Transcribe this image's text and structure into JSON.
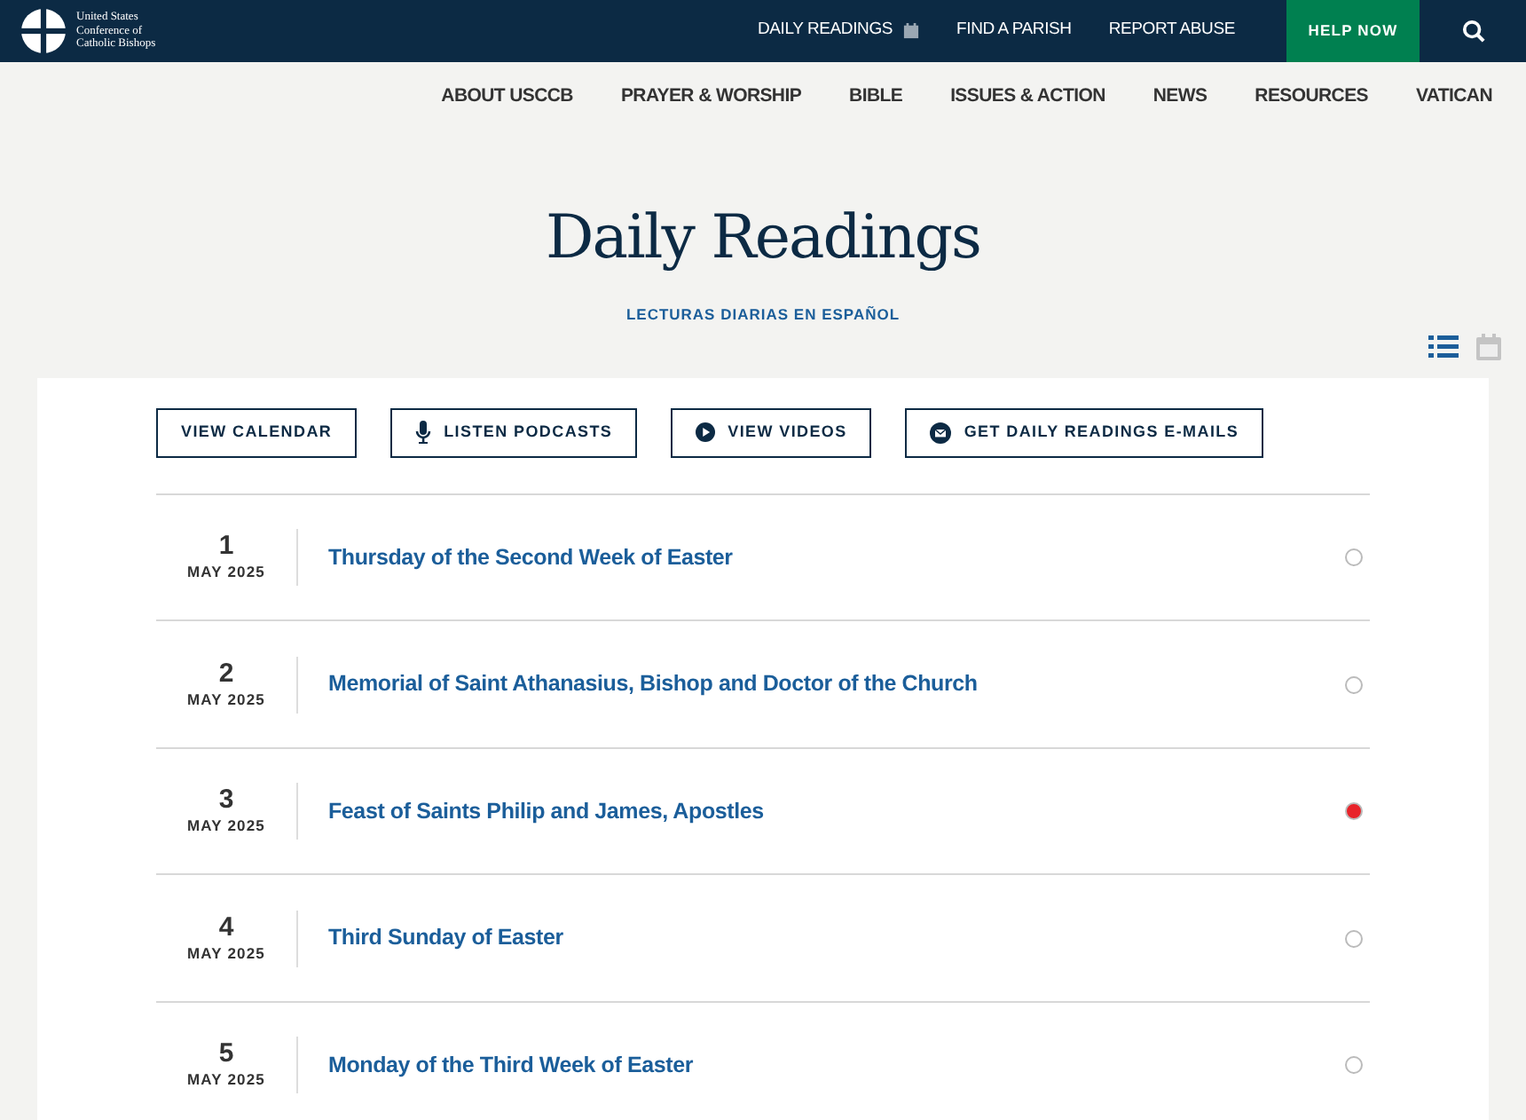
{
  "logo": {
    "lines": [
      "United States",
      "Conference of",
      "Catholic Bishops"
    ]
  },
  "top_links": [
    {
      "label": "DAILY READINGS",
      "kind": "calendar"
    },
    {
      "label": "FIND A PARISH",
      "kind": "plain"
    },
    {
      "label": "REPORT ABUSE",
      "kind": "plain"
    }
  ],
  "help_button": "HELP NOW",
  "main_nav": [
    "ABOUT USCCB",
    "PRAYER & WORSHIP",
    "BIBLE",
    "ISSUES & ACTION",
    "NEWS",
    "RESOURCES",
    "VATICAN"
  ],
  "title": "Daily Readings",
  "subtitle_link": "LECTURAS DIARIAS EN ESPAÑOL",
  "view_toggle": [
    {
      "kind": "list",
      "selected": true
    },
    {
      "kind": "calendar",
      "selected": false
    }
  ],
  "actions": [
    {
      "label": "VIEW CALENDAR",
      "kind": "plain"
    },
    {
      "label": "LISTEN PODCASTS",
      "kind": "mic"
    },
    {
      "label": "VIEW VIDEOS",
      "kind": "play"
    },
    {
      "label": "GET DAILY READINGS E-MAILS",
      "kind": "mail"
    }
  ],
  "readings": [
    {
      "day": "1",
      "month": "MAY 2025",
      "title": "Thursday of the Second Week of Easter",
      "color": "#ffffff"
    },
    {
      "day": "2",
      "month": "MAY 2025",
      "title": "Memorial of Saint Athanasius, Bishop and Doctor of the Church",
      "color": "#ffffff"
    },
    {
      "day": "3",
      "month": "MAY 2025",
      "title": "Feast of Saints Philip and James, Apostles",
      "color": "#e8232a"
    },
    {
      "day": "4",
      "month": "MAY 2025",
      "title": "Third Sunday of Easter",
      "color": "#ffffff"
    },
    {
      "day": "5",
      "month": "MAY 2025",
      "title": "Monday of the Third Week of Easter",
      "color": "#ffffff"
    }
  ]
}
